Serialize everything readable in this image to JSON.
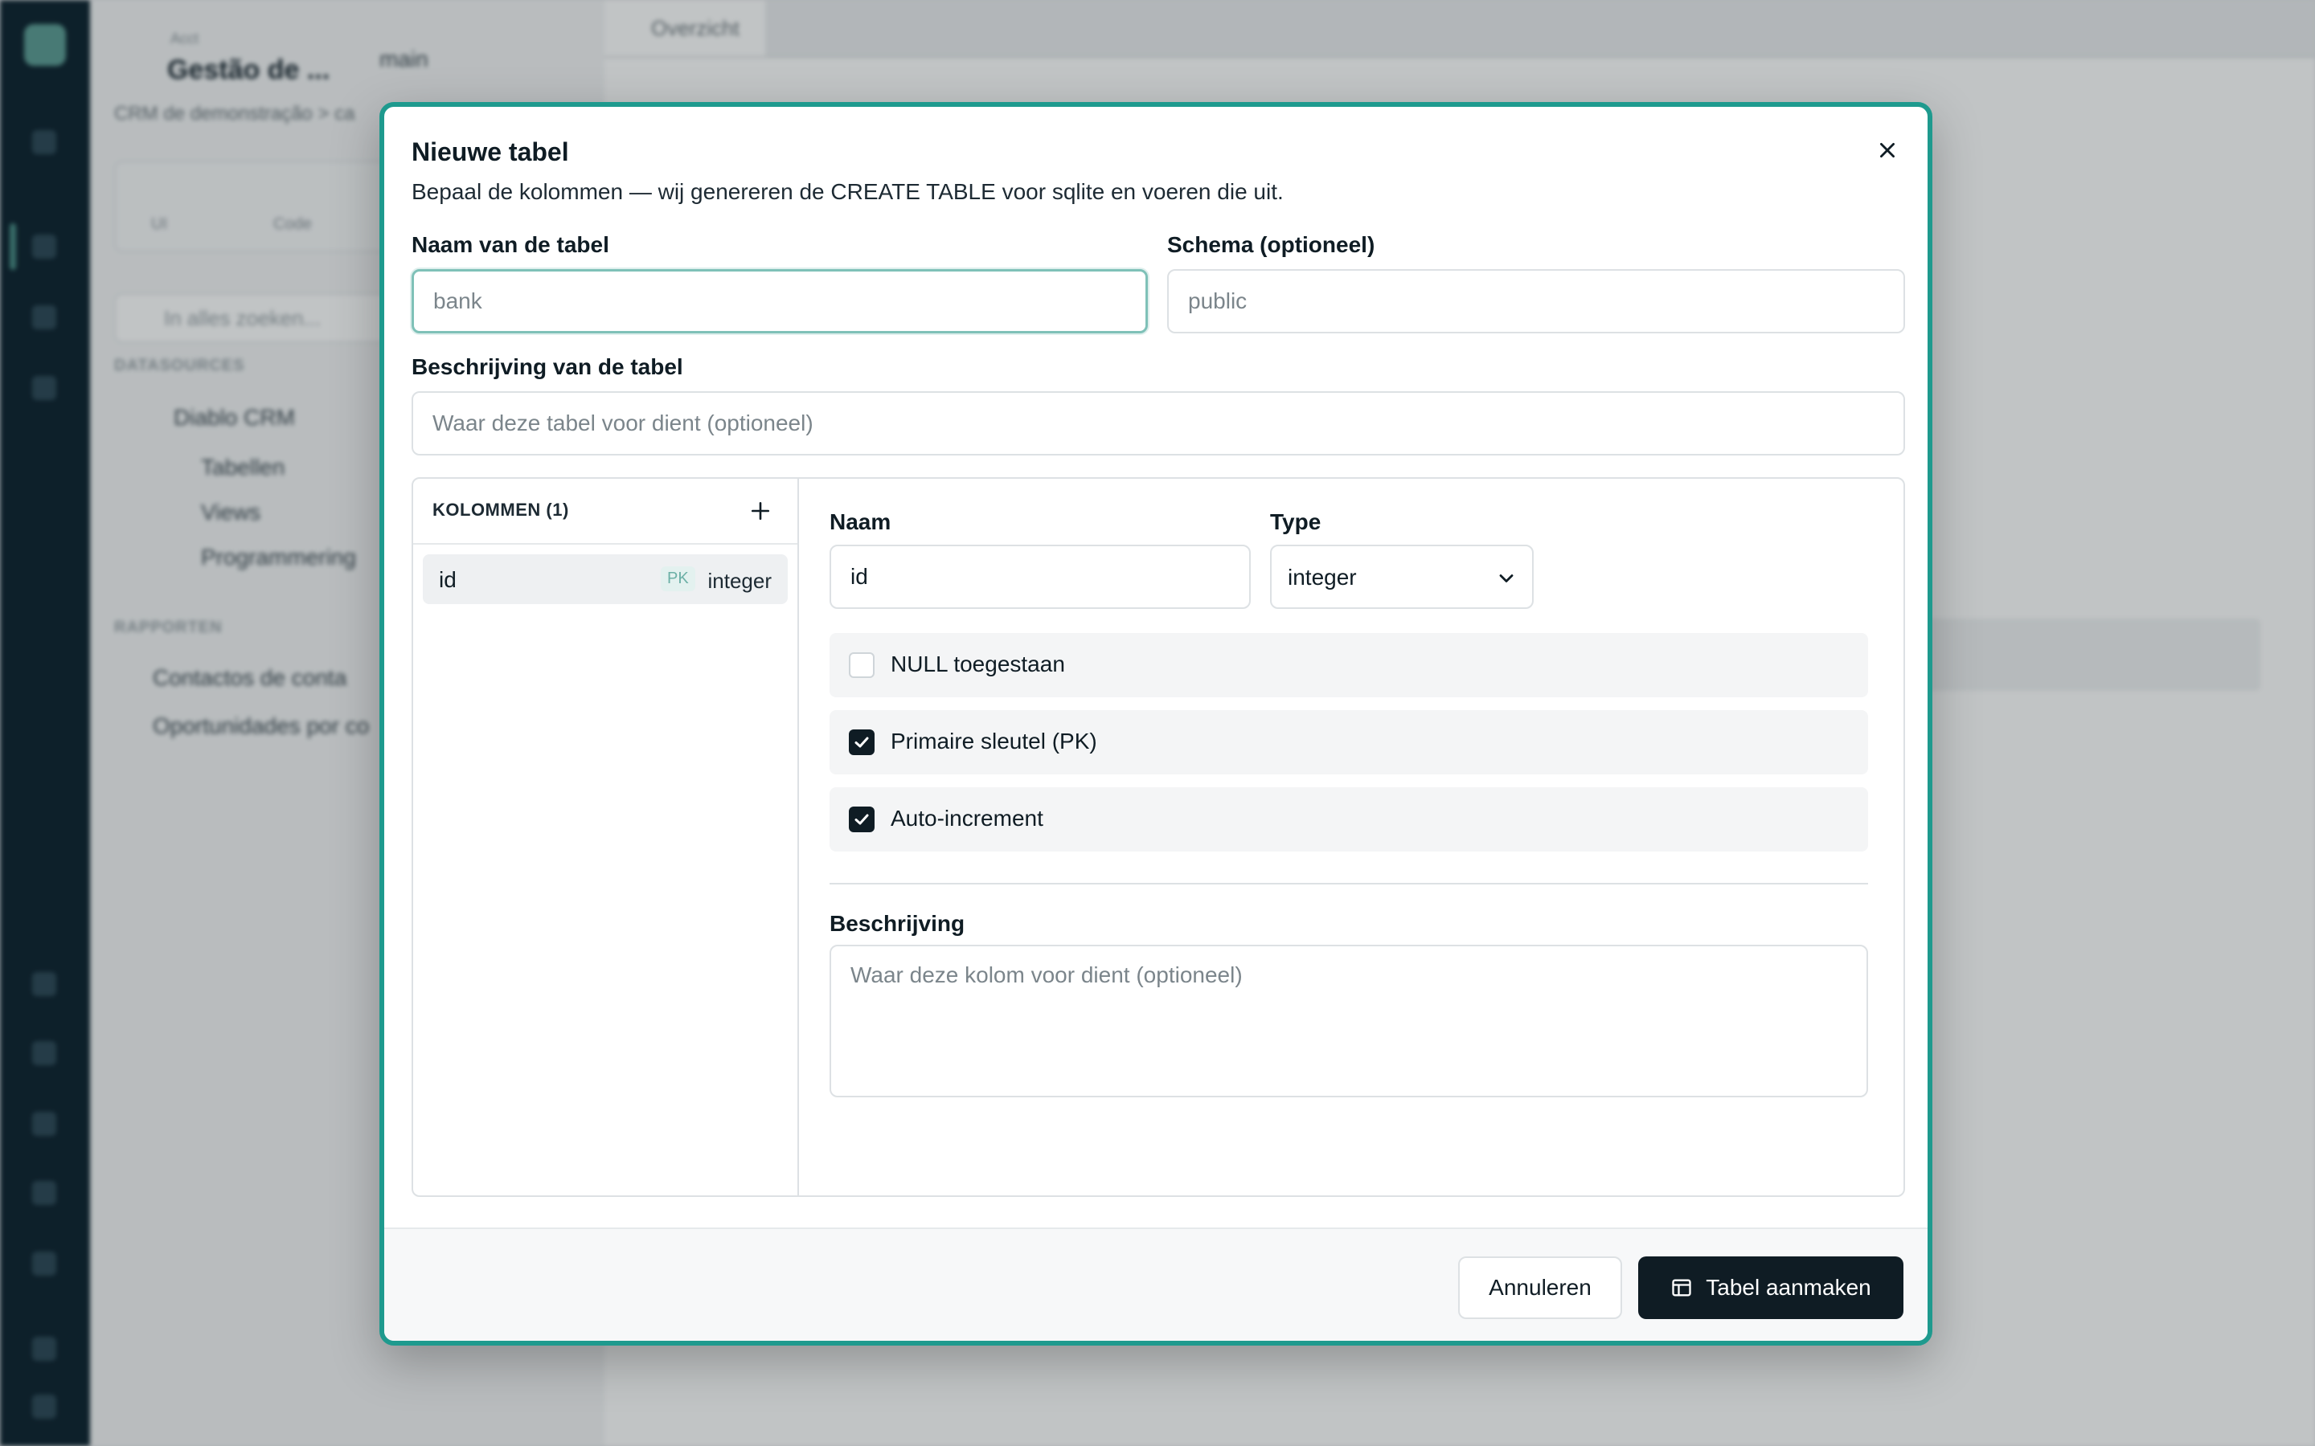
{
  "background": {
    "workspace_small": "Acct",
    "workspace_title": "Gestão de ...",
    "branch": "main",
    "breadcrumb": "CRM de demonstração > ca",
    "tab_names": [
      "UI",
      "Code"
    ],
    "search_placeholder": "In alles zoeken...",
    "section_datasources": "DATASOURCES",
    "tree_root": "Diablo CRM",
    "tree_items": [
      "Tabellen",
      "Views",
      "Programmering"
    ],
    "section_reports": "RAPPORTEN",
    "reports": [
      "Contactos de conta",
      "Oportunidades por co"
    ],
    "doc_tab": "Overzicht"
  },
  "modal": {
    "title": "Nieuwe tabel",
    "description": "Bepaal de kolommen — wij genereren de CREATE TABLE voor sqlite en voeren die uit.",
    "table_name": {
      "label": "Naam van de tabel",
      "placeholder": "bank",
      "value": ""
    },
    "schema": {
      "label": "Schema (optioneel)",
      "placeholder": "public",
      "value": ""
    },
    "table_description": {
      "label": "Beschrijving van de tabel",
      "placeholder": "Waar deze tabel voor dient (optioneel)",
      "value": ""
    },
    "columns_header": "KOLOMMEN (1)",
    "columns": [
      {
        "name": "id",
        "badge": "PK",
        "type": "integer"
      }
    ],
    "detail": {
      "name_label": "Naam",
      "name_value": "id",
      "type_label": "Type",
      "type_value": "integer",
      "options": [
        {
          "label": "NULL toegestaan",
          "checked": false
        },
        {
          "label": "Primaire sleutel (PK)",
          "checked": true
        },
        {
          "label": "Auto-increment",
          "checked": true
        }
      ],
      "description_label": "Beschrijving",
      "description_placeholder": "Waar deze kolom voor dient (optioneel)"
    },
    "cancel_label": "Annuleren",
    "create_label": "Tabel aanmaken"
  },
  "colors": {
    "accent": "#1e9a8e",
    "primary_dark": "#0f1c24",
    "sidebar_rail": "#0f2430"
  },
  "icons": [
    "close-icon",
    "plus-icon",
    "chevron-down-icon",
    "checkmark-icon",
    "table-icon"
  ]
}
